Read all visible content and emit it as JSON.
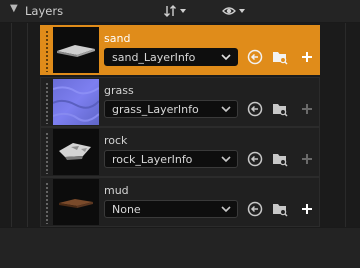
{
  "panel": {
    "title": "Layers",
    "collapse_icon": "triangle-down-icon",
    "filter_icon": "sort-arrows-icon",
    "visibility_icon": "eye-icon"
  },
  "colors": {
    "accent_selected": "#e08c1a",
    "row_background": "#202020",
    "panel_background": "#1b1b1b"
  },
  "layers": [
    {
      "name": "sand",
      "layer_info": "sand_LayerInfo",
      "selected": true,
      "thumbnail_icon": "sand-texture-thumbnail"
    },
    {
      "name": "grass",
      "layer_info": "grass_LayerInfo",
      "selected": false,
      "thumbnail_icon": "grass-texture-thumbnail"
    },
    {
      "name": "rock",
      "layer_info": "rock_LayerInfo",
      "selected": false,
      "thumbnail_icon": "rock-texture-thumbnail"
    },
    {
      "name": "mud",
      "layer_info": "None",
      "selected": false,
      "thumbnail_icon": "mud-texture-thumbnail"
    }
  ]
}
